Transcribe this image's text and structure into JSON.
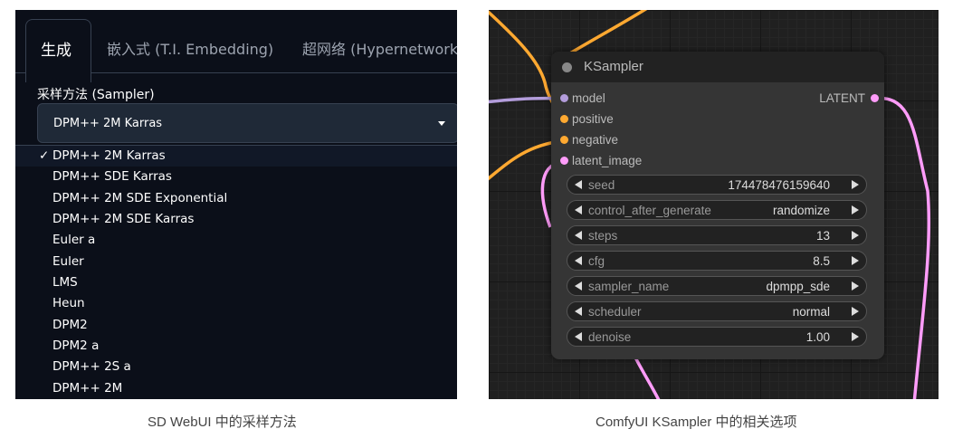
{
  "sd_webui": {
    "tabs": [
      {
        "label": "生成",
        "active": true
      },
      {
        "label": "嵌入式 (T.I. Embedding)",
        "active": false
      },
      {
        "label": "超网络 (Hypernetwork",
        "active": false
      }
    ],
    "sampler_label": "采样方法 (Sampler)",
    "sampler_selected": "DPM++ 2M Karras",
    "check_mark": "✓",
    "options": [
      "DPM++ 2M Karras",
      "DPM++ SDE Karras",
      "DPM++ 2M SDE Exponential",
      "DPM++ 2M SDE Karras",
      "Euler a",
      "Euler",
      "LMS",
      "Heun",
      "DPM2",
      "DPM2 a",
      "DPM++ 2S a",
      "DPM++ 2M"
    ]
  },
  "comfyui": {
    "node_title": "KSampler",
    "inputs": [
      {
        "name": "model",
        "color": "#b39ddb"
      },
      {
        "name": "positive",
        "color": "#ffa931"
      },
      {
        "name": "negative",
        "color": "#ffa931"
      },
      {
        "name": "latent_image",
        "color": "#ff9cf9"
      }
    ],
    "output": {
      "name": "LATENT",
      "color": "#ff9cf9"
    },
    "widgets": [
      {
        "name": "seed",
        "value": "174478476159640"
      },
      {
        "name": "control_after_generate",
        "value": "randomize"
      },
      {
        "name": "steps",
        "value": "13"
      },
      {
        "name": "cfg",
        "value": "8.5"
      },
      {
        "name": "sampler_name",
        "value": "dpmpp_sde"
      },
      {
        "name": "scheduler",
        "value": "normal"
      },
      {
        "name": "denoise",
        "value": "1.00"
      }
    ]
  },
  "captions": {
    "left": "SD WebUI 中的采样方法",
    "right": "ComfyUI KSampler 中的相关选项"
  },
  "colors": {
    "wire_orange": "#ffa931",
    "wire_purple": "#b39ddb",
    "wire_pink": "#ff9cf9"
  }
}
